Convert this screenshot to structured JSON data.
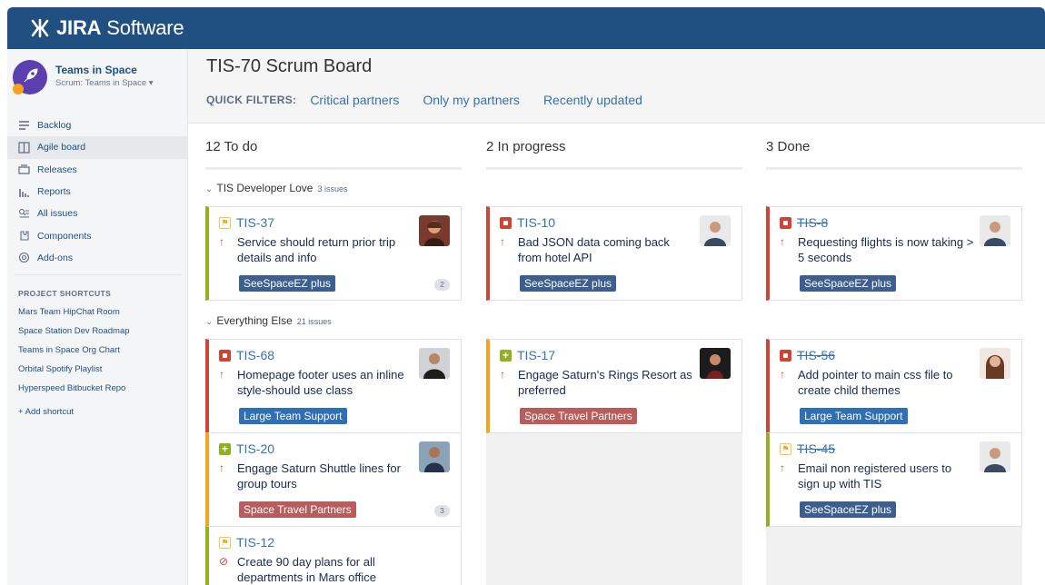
{
  "app": {
    "name_bold": "JIRA",
    "name_rest": " Software"
  },
  "project": {
    "name": "Teams in Space",
    "board_select": "Scrum: Teams in Space ▾"
  },
  "nav": [
    {
      "label": "Backlog",
      "icon": "backlog-icon"
    },
    {
      "label": "Agile board",
      "icon": "board-icon",
      "active": true
    },
    {
      "label": "Releases",
      "icon": "releases-icon"
    },
    {
      "label": "Reports",
      "icon": "reports-icon"
    },
    {
      "label": "All issues",
      "icon": "issues-icon"
    },
    {
      "label": "Components",
      "icon": "components-icon"
    },
    {
      "label": "Add-ons",
      "icon": "addons-icon"
    }
  ],
  "shortcuts": {
    "title": "PROJECT SHORTCUTS",
    "items": [
      "Mars Team HipChat Room",
      "Space Station Dev Roadmap",
      "Teams in Space Org Chart",
      "Orbital Spotify Playlist",
      "Hyperspeed Bitbucket Repo"
    ],
    "add": "+ Add shortcut"
  },
  "board": {
    "title": "TIS-70 Scrum Board",
    "quick_filters_label": "QUICK FILTERS:",
    "quick_filters": [
      "Critical partners",
      "Only my partners",
      "Recently updated"
    ]
  },
  "columns": [
    {
      "count": "12",
      "name": "To do"
    },
    {
      "count": "2",
      "name": "In progress"
    },
    {
      "count": "3",
      "name": "Done"
    }
  ],
  "swimlanes": [
    {
      "name": "TIS Developer Love",
      "count": "3 issues"
    },
    {
      "name": "Everything Else",
      "count": "21 issues"
    }
  ],
  "cards": {
    "c1": {
      "key": "TIS-37",
      "type": "improvement",
      "priority": "major",
      "summary": "Service should return prior trip details and info",
      "epic": "SeeSpaceEZ plus",
      "badge": "2",
      "border": "#8eb021"
    },
    "c2": {
      "key": "TIS-10",
      "type": "bug",
      "priority": "major",
      "summary": "Bad JSON data coming back from hotel API",
      "epic": "SeeSpaceEZ plus",
      "border": "#d04437"
    },
    "c3": {
      "key": "TIS-8",
      "type": "bug",
      "priority": "major",
      "summary": "Requesting flights is now taking > 5 seconds",
      "epic": "SeeSpaceEZ plus",
      "border": "#d04437"
    },
    "c4": {
      "key": "TIS-68",
      "type": "bug",
      "priority": "major",
      "summary": "Homepage footer uses an inline style-should use class",
      "epic": "Large Team Support",
      "border": "#d04437"
    },
    "c5": {
      "key": "TIS-17",
      "type": "story",
      "priority": "major",
      "summary": "Engage Saturn's Rings Resort as preferred",
      "epic": "Space Travel Partners",
      "border": "#f6a21c"
    },
    "c6": {
      "key": "TIS-56",
      "type": "bug",
      "priority": "major",
      "summary": "Add pointer to main css file to create child themes",
      "epic": "Large Team Support",
      "border": "#d04437"
    },
    "c7": {
      "key": "TIS-20",
      "type": "story",
      "priority": "major",
      "summary": "Engage Saturn Shuttle lines for group tours",
      "epic": "Space Travel Partners",
      "badge": "3",
      "border": "#f6a21c"
    },
    "c8": {
      "key": "TIS-45",
      "type": "improvement",
      "priority": "major",
      "summary": "Email non registered users to sign up with TIS",
      "epic": "SeeSpaceEZ plus",
      "border": "#8eb021"
    },
    "c9": {
      "key": "TIS-12",
      "type": "improvement",
      "priority": "blocker",
      "summary": "Create 90 day plans for all departments in Mars office",
      "border": "#8eb021"
    }
  },
  "colors": {
    "header": "#205081",
    "link": "#3572b0",
    "bug": "#d04437",
    "story": "#8eb021",
    "improvement": "#f6c342"
  }
}
